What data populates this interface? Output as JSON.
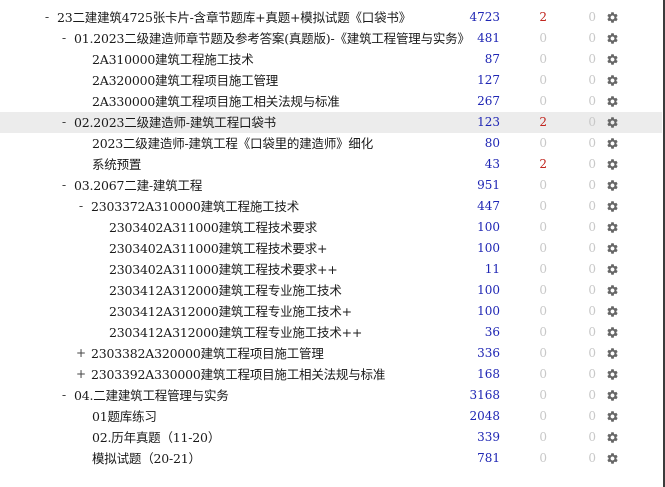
{
  "deck_tree": {
    "rows": [
      {
        "toggle": "-",
        "name": "23二建建筑4725张卡片-含章节题库+真题+模拟试题《口袋书》",
        "new": "4723",
        "learn": "2",
        "due": "0",
        "gear_icon": "gear-icon"
      },
      {
        "toggle": "-",
        "name": "01.2023二级建造师章节题及参考答案(真题版)-《建筑工程管理与实务》",
        "new": "481",
        "learn": "0",
        "due": "0",
        "gear_icon": "gear-icon"
      },
      {
        "toggle": "",
        "name": "2A310000建筑工程施工技术",
        "new": "87",
        "learn": "0",
        "due": "0",
        "gear_icon": "gear-icon"
      },
      {
        "toggle": "",
        "name": "2A320000建筑工程项目施工管理",
        "new": "127",
        "learn": "0",
        "due": "0",
        "gear_icon": "gear-icon"
      },
      {
        "toggle": "",
        "name": "2A330000建筑工程项目施工相关法规与标准",
        "new": "267",
        "learn": "0",
        "due": "0",
        "gear_icon": "gear-icon"
      },
      {
        "toggle": "-",
        "name": "02.2023二级建造师-建筑工程口袋书",
        "new": "123",
        "learn": "2",
        "due": "0",
        "gear_icon": "gear-icon"
      },
      {
        "toggle": "",
        "name": "2023二级建造师-建筑工程《口袋里的建造师》细化",
        "new": "80",
        "learn": "0",
        "due": "0",
        "gear_icon": "gear-icon"
      },
      {
        "toggle": "",
        "name": "系统预置",
        "new": "43",
        "learn": "2",
        "due": "0",
        "gear_icon": "gear-icon"
      },
      {
        "toggle": "-",
        "name": "03.2067二建-建筑工程",
        "new": "951",
        "learn": "0",
        "due": "0",
        "gear_icon": "gear-icon"
      },
      {
        "toggle": "-",
        "name": "2303372A310000建筑工程施工技术",
        "new": "447",
        "learn": "0",
        "due": "0",
        "gear_icon": "gear-icon"
      },
      {
        "toggle": "",
        "name": "2303402A311000建筑工程技术要求",
        "new": "100",
        "learn": "0",
        "due": "0",
        "gear_icon": "gear-icon"
      },
      {
        "toggle": "",
        "name": "2303402A311000建筑工程技术要求+",
        "new": "100",
        "learn": "0",
        "due": "0",
        "gear_icon": "gear-icon"
      },
      {
        "toggle": "",
        "name": "2303402A311000建筑工程技术要求++",
        "new": "11",
        "learn": "0",
        "due": "0",
        "gear_icon": "gear-icon"
      },
      {
        "toggle": "",
        "name": "2303412A312000建筑工程专业施工技术",
        "new": "100",
        "learn": "0",
        "due": "0",
        "gear_icon": "gear-icon"
      },
      {
        "toggle": "",
        "name": "2303412A312000建筑工程专业施工技术+",
        "new": "100",
        "learn": "0",
        "due": "0",
        "gear_icon": "gear-icon"
      },
      {
        "toggle": "",
        "name": "2303412A312000建筑工程专业施工技术++",
        "new": "36",
        "learn": "0",
        "due": "0",
        "gear_icon": "gear-icon"
      },
      {
        "toggle": "+",
        "name": "2303382A320000建筑工程项目施工管理",
        "new": "336",
        "learn": "0",
        "due": "0",
        "gear_icon": "gear-icon"
      },
      {
        "toggle": "+",
        "name": "2303392A330000建筑工程项目施工相关法规与标准",
        "new": "168",
        "learn": "0",
        "due": "0",
        "gear_icon": "gear-icon"
      },
      {
        "toggle": "-",
        "name": "04.二建建筑工程管理与实务",
        "new": "3168",
        "learn": "0",
        "due": "0",
        "gear_icon": "gear-icon"
      },
      {
        "toggle": "",
        "name": "01题库练习",
        "new": "2048",
        "learn": "0",
        "due": "0",
        "gear_icon": "gear-icon"
      },
      {
        "toggle": "",
        "name": "02.历年真题（11-20）",
        "new": "339",
        "learn": "0",
        "due": "0",
        "gear_icon": "gear-icon"
      },
      {
        "toggle": "",
        "name": "模拟试题（20-21）",
        "new": "781",
        "learn": "0",
        "due": "0",
        "gear_icon": "gear-icon"
      }
    ]
  }
}
